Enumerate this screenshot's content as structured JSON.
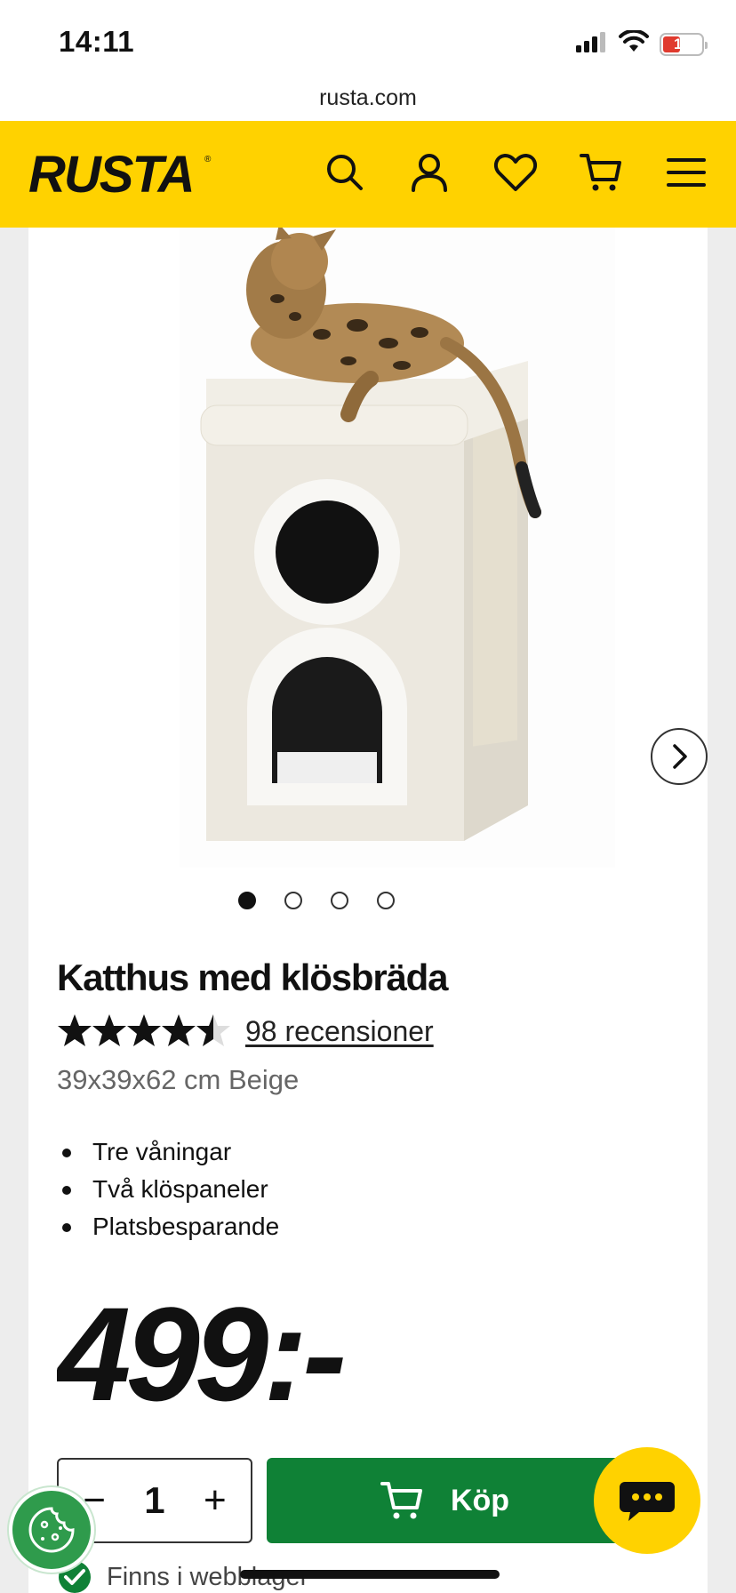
{
  "status_bar": {
    "time": "14:11",
    "battery": "11"
  },
  "browser": {
    "url": "rusta.com"
  },
  "header": {
    "logo_text": "RUSTA",
    "icons": [
      "search-icon",
      "account-icon",
      "heart-icon",
      "cart-icon",
      "menu-icon"
    ]
  },
  "gallery": {
    "image_count": 4,
    "active_index": 0
  },
  "product": {
    "title": "Katthus med klösbräda",
    "rating": 4.5,
    "reviews_text": "98 recensioner",
    "subtitle": "39x39x62 cm Beige",
    "features": [
      "Tre våningar",
      "Två klöspaneler",
      "Platsbesparande"
    ],
    "price": "499:-"
  },
  "purchase": {
    "minus_label": "−",
    "quantity": "1",
    "plus_label": "+",
    "buy_label": "Köp"
  },
  "stock": {
    "text": "Finns i webblager"
  },
  "colors": {
    "brand_yellow": "#ffd200",
    "buy_green": "#0f8136"
  }
}
